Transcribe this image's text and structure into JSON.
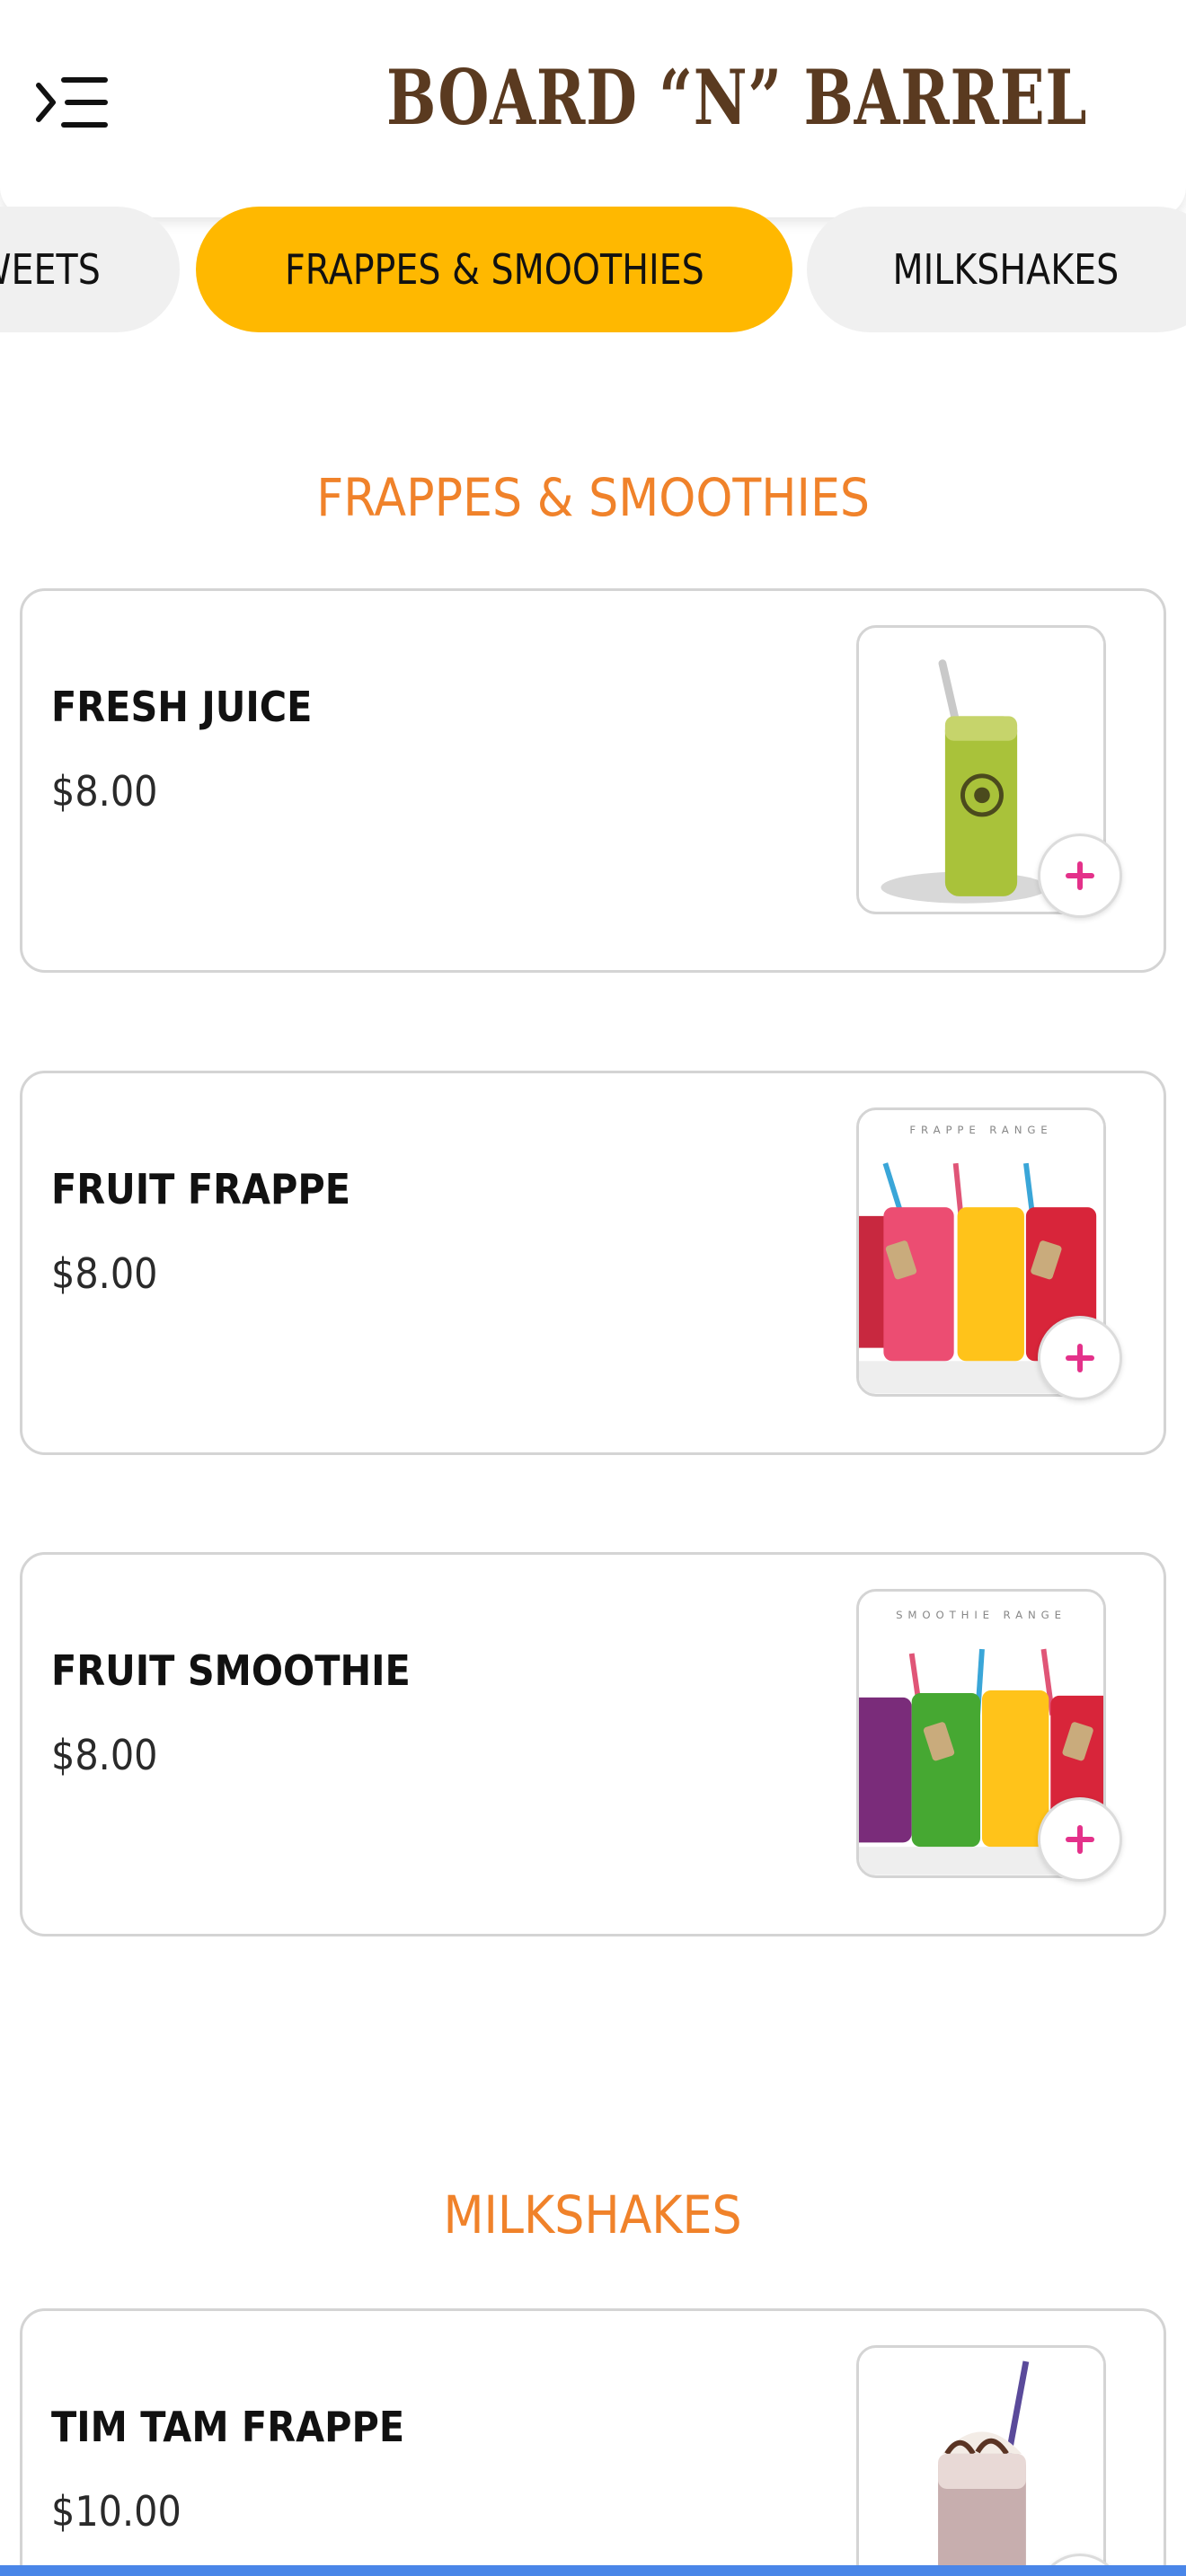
{
  "header": {
    "brand": "BOARD “N” BARREL",
    "brand_color": "#5a3a20",
    "menu_icon": "menu-icon"
  },
  "tabs": [
    {
      "label": "SWEETS",
      "visible_text": "WEETS",
      "active": false
    },
    {
      "label": "FRAPPES & SMOOTHIES",
      "active": true
    },
    {
      "label": "MILKSHAKES",
      "active": false
    }
  ],
  "accent_color": "#ffb800",
  "section_title_color": "#f0822a",
  "add_button_color": "#e4318a",
  "sections": [
    {
      "title": "FRAPPES & SMOOTHIES",
      "items": [
        {
          "name": "FRESH JUICE",
          "price": "$8.00",
          "image": "green-juice-cup-image"
        },
        {
          "name": "FRUIT FRAPPE",
          "price": "$8.00",
          "image": "frappe-range-glasses-image",
          "image_caption": "FRAPPE RANGE"
        },
        {
          "name": "FRUIT SMOOTHIE",
          "price": "$8.00",
          "image": "smoothie-range-glasses-image",
          "image_caption": "SMOOTHIE RANGE"
        }
      ]
    },
    {
      "title": "MILKSHAKES",
      "items": [
        {
          "name": "TIM TAM FRAPPE",
          "price": "$10.00",
          "image": "milkshake-glass-image"
        }
      ]
    }
  ]
}
